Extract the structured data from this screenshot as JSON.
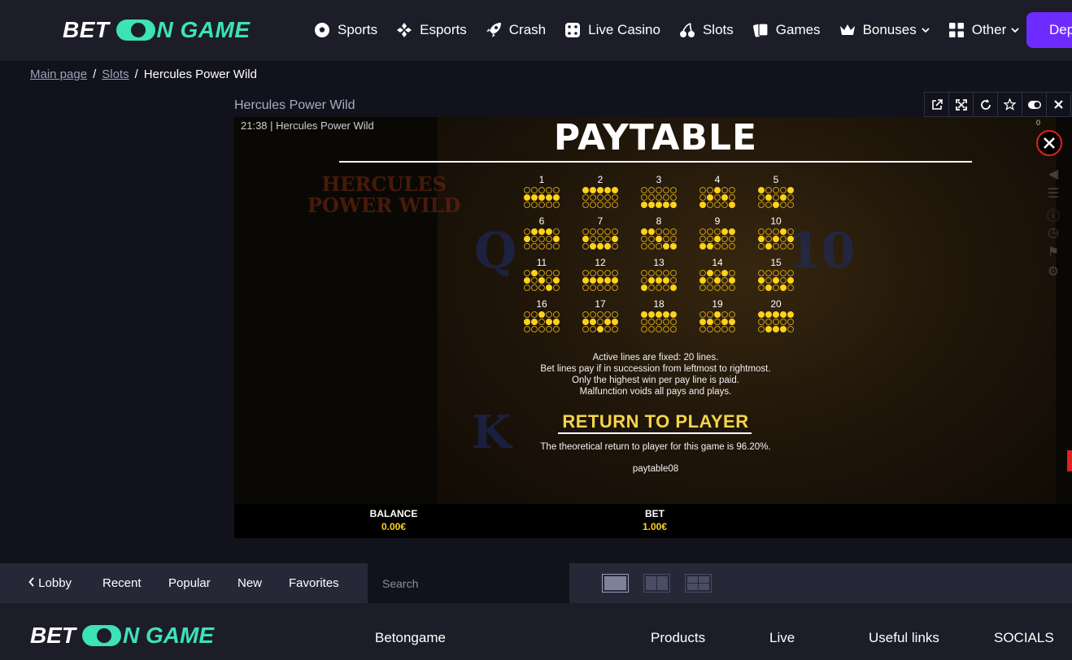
{
  "header": {
    "logo": {
      "part1": "BET",
      "part2": "N GAME"
    },
    "nav": [
      {
        "label": "Sports",
        "icon": "soccer-ball-icon"
      },
      {
        "label": "Esports",
        "icon": "gamepad-icon"
      },
      {
        "label": "Crash",
        "icon": "rocket-icon"
      },
      {
        "label": "Live Casino",
        "icon": "dice-icon"
      },
      {
        "label": "Slots",
        "icon": "cherries-icon"
      },
      {
        "label": "Games",
        "icon": "cards-icon"
      },
      {
        "label": "Bonuses",
        "icon": "crown-icon",
        "dropdown": true
      },
      {
        "label": "Other",
        "icon": "grid-icon",
        "dropdown": true
      }
    ],
    "deposit_label": "Deposit",
    "deposit_visible": "Dep"
  },
  "breadcrumb": {
    "items": [
      "Main page",
      "Slots"
    ],
    "current": "Hercules Power Wild"
  },
  "game": {
    "title": "Hercules Power Wild",
    "tools": [
      "external-link-icon",
      "fullscreen-icon",
      "reload-icon",
      "star-icon",
      "toggle-icon",
      "close-icon"
    ],
    "frame_header": "21:38 | Hercules Power Wild",
    "bg_logo": "HERCULES\nPOWER WILD",
    "paytable": {
      "title": "PAYTABLE",
      "lines": [
        {
          "n": "1",
          "rows": [
            0,
            0,
            0,
            0,
            0,
            1,
            1,
            1,
            1,
            1,
            0,
            0,
            0,
            0,
            0
          ]
        },
        {
          "n": "2",
          "rows": [
            1,
            1,
            1,
            1,
            1,
            0,
            0,
            0,
            0,
            0,
            0,
            0,
            0,
            0,
            0
          ]
        },
        {
          "n": "3",
          "rows": [
            0,
            0,
            0,
            0,
            0,
            0,
            0,
            0,
            0,
            0,
            1,
            1,
            1,
            1,
            1
          ]
        },
        {
          "n": "4",
          "rows": [
            0,
            0,
            1,
            0,
            0,
            0,
            1,
            0,
            1,
            0,
            1,
            0,
            0,
            0,
            1
          ]
        },
        {
          "n": "5",
          "rows": [
            1,
            0,
            0,
            0,
            1,
            0,
            1,
            0,
            1,
            0,
            0,
            0,
            1,
            0,
            0
          ]
        },
        {
          "n": "6",
          "rows": [
            0,
            1,
            1,
            1,
            0,
            1,
            0,
            0,
            0,
            1,
            0,
            0,
            0,
            0,
            0
          ]
        },
        {
          "n": "7",
          "rows": [
            0,
            0,
            0,
            0,
            0,
            1,
            0,
            0,
            0,
            1,
            0,
            1,
            1,
            1,
            0
          ]
        },
        {
          "n": "8",
          "rows": [
            1,
            1,
            0,
            0,
            0,
            0,
            0,
            1,
            0,
            0,
            0,
            0,
            0,
            1,
            1
          ]
        },
        {
          "n": "9",
          "rows": [
            0,
            0,
            0,
            1,
            1,
            0,
            0,
            1,
            0,
            0,
            1,
            1,
            0,
            0,
            0
          ]
        },
        {
          "n": "10",
          "rows": [
            0,
            0,
            0,
            1,
            0,
            1,
            0,
            1,
            0,
            1,
            0,
            1,
            0,
            0,
            0
          ]
        },
        {
          "n": "11",
          "rows": [
            0,
            1,
            0,
            0,
            0,
            1,
            0,
            1,
            0,
            1,
            0,
            0,
            0,
            1,
            0
          ]
        },
        {
          "n": "12",
          "rows": [
            0,
            0,
            0,
            0,
            0,
            1,
            1,
            1,
            1,
            1,
            0,
            0,
            0,
            0,
            0
          ]
        },
        {
          "n": "13",
          "rows": [
            0,
            0,
            0,
            0,
            0,
            0,
            1,
            1,
            1,
            0,
            1,
            0,
            0,
            0,
            1
          ]
        },
        {
          "n": "14",
          "rows": [
            0,
            1,
            0,
            1,
            0,
            1,
            0,
            1,
            0,
            1,
            0,
            0,
            0,
            0,
            0
          ]
        },
        {
          "n": "15",
          "rows": [
            0,
            0,
            0,
            0,
            0,
            1,
            0,
            1,
            0,
            1,
            0,
            1,
            0,
            1,
            0
          ]
        },
        {
          "n": "16",
          "rows": [
            0,
            0,
            1,
            0,
            0,
            1,
            1,
            0,
            1,
            1,
            0,
            0,
            0,
            0,
            0
          ]
        },
        {
          "n": "17",
          "rows": [
            0,
            0,
            0,
            0,
            0,
            1,
            1,
            0,
            1,
            1,
            0,
            0,
            1,
            0,
            0
          ]
        },
        {
          "n": "18",
          "rows": [
            1,
            1,
            1,
            1,
            1,
            0,
            0,
            0,
            0,
            0,
            0,
            0,
            0,
            0,
            0
          ]
        },
        {
          "n": "19",
          "rows": [
            0,
            0,
            1,
            0,
            0,
            1,
            1,
            0,
            1,
            1,
            0,
            0,
            0,
            0,
            0
          ]
        },
        {
          "n": "20",
          "rows": [
            1,
            1,
            1,
            1,
            1,
            0,
            0,
            0,
            0,
            0,
            0,
            1,
            1,
            1,
            0
          ]
        }
      ],
      "rules": [
        "Active lines are fixed: 20 lines.",
        "Bet lines pay if in succession from leftmost to rightmost.",
        "Only the highest win per pay line is paid.",
        "Malfunction voids all pays and plays."
      ],
      "rtp_title": "RETURN TO PLAYER",
      "rtp_text": "The theoretical return to player for this game is 96.20%.",
      "code": "paytable08",
      "counter": "0"
    },
    "balance": {
      "label": "BALANCE",
      "value": "0.00€"
    },
    "bet": {
      "label": "BET",
      "value": "1.00€"
    }
  },
  "lobby_bar": {
    "lobby": "Lobby",
    "tabs": [
      "Recent",
      "Popular",
      "New",
      "Favorites"
    ],
    "search_placeholder": "Search"
  },
  "footer": {
    "logo": {
      "part1": "BET",
      "part2": "N GAME"
    },
    "columns": [
      "Betongame",
      "Products",
      "Live",
      "Useful links",
      "SOCIALS"
    ]
  },
  "colors": {
    "accent": "#3de2b7",
    "deposit": "#6e2bff",
    "gold": "#ffd21a",
    "bg": "#11121b"
  }
}
